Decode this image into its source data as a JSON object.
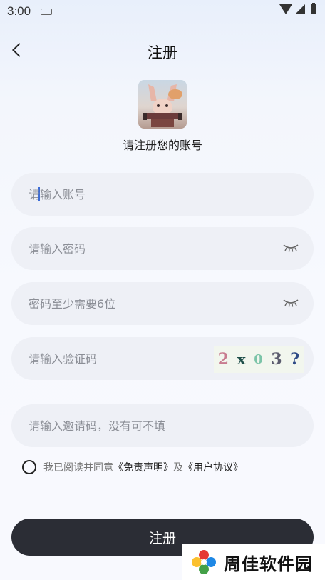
{
  "status_bar": {
    "time": "3:00"
  },
  "nav": {
    "title": "注册"
  },
  "header": {
    "subtitle": "请注册您的账号"
  },
  "form": {
    "account_placeholder": "请输入账号",
    "password_placeholder": "请输入密码",
    "confirm_placeholder": "密码至少需要6位",
    "captcha_placeholder": "请输入验证码",
    "captcha_chars": [
      "2",
      "x",
      "0",
      "3",
      "?"
    ],
    "invite_placeholder": "请输入邀请码，没有可不填"
  },
  "agreement": {
    "prefix": "我已阅读并同意",
    "disclaimer_link": "《免责声明》",
    "conjunction": "及",
    "protocol_link": "《用户协议》"
  },
  "actions": {
    "submit_label": "注册"
  },
  "watermark": {
    "text": "周佳软件园"
  },
  "colors": {
    "button_bg": "#2b2d35",
    "field_bg": "#eef0f6",
    "caret": "#3b6cd7"
  }
}
